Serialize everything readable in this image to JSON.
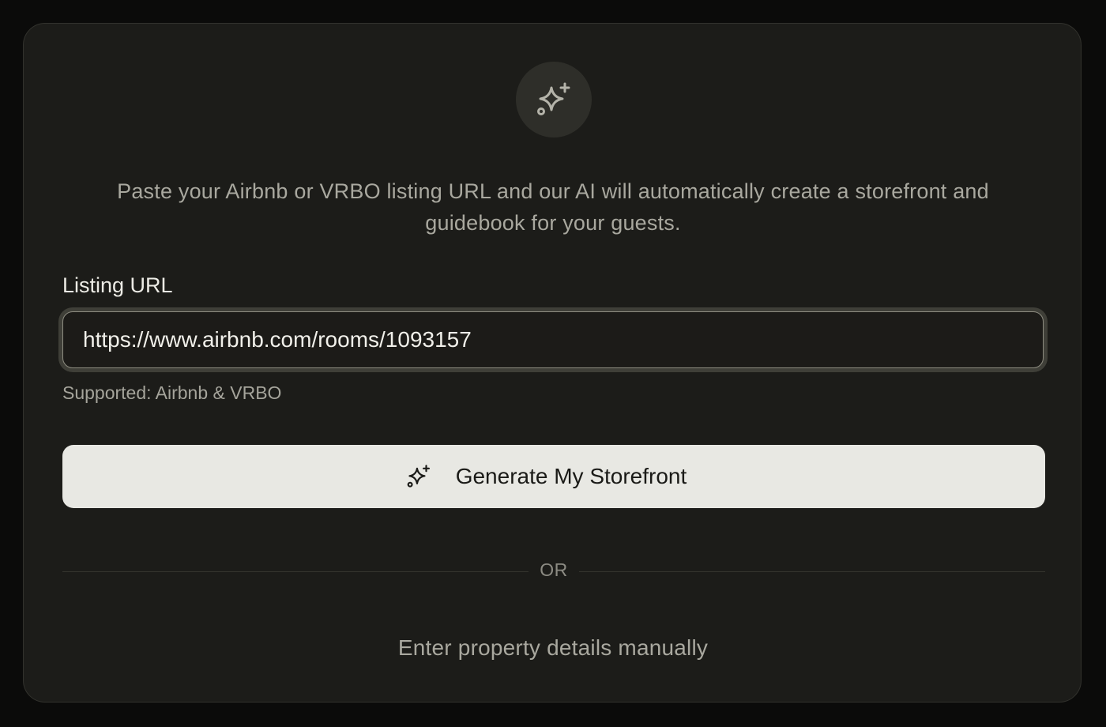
{
  "hero": {
    "icon": "sparkles-icon",
    "description": "Paste your Airbnb or VRBO listing URL and our AI will automatically create a storefront and guidebook for your guests."
  },
  "form": {
    "label": "Listing URL",
    "url_value": "https://www.airbnb.com/rooms/1093157",
    "helper": "Supported: Airbnb & VRBO",
    "generate_label": "Generate My Storefront",
    "generate_icon": "sparkles-icon"
  },
  "divider": {
    "text": "OR"
  },
  "manual": {
    "label": "Enter property details manually"
  },
  "colors": {
    "background": "#0b0b0a",
    "card": "#1c1c19",
    "button": "#e8e8e3",
    "muted_text": "#a9a89f"
  }
}
